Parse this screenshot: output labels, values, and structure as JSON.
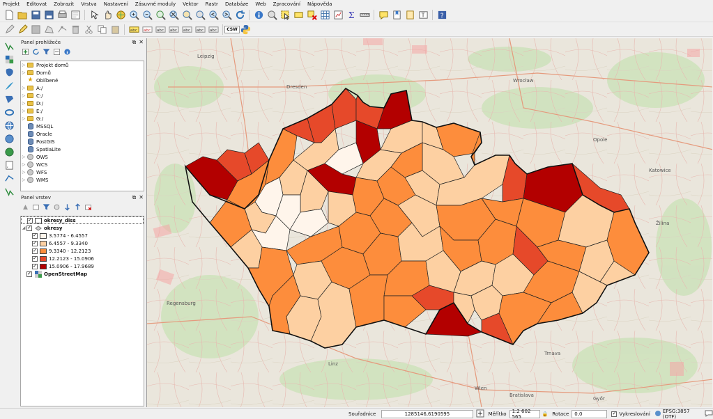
{
  "menu": [
    "Projekt",
    "Editovat",
    "Zobrazit",
    "Vrstva",
    "Nastavení",
    "Zásuvné moduly",
    "Vektor",
    "Rastr",
    "Databáze",
    "Web",
    "Zpracování",
    "Nápověda"
  ],
  "toolbar": {
    "csw_label": "CSW"
  },
  "browser_panel": {
    "title": "Panel prohlížeče",
    "items": [
      {
        "label": "Projekt domů",
        "icon": "folder-icon"
      },
      {
        "label": "Domů",
        "icon": "folder-icon"
      },
      {
        "label": "Oblíbené",
        "icon": "star-icon"
      },
      {
        "label": "A:/",
        "icon": "folder-icon"
      },
      {
        "label": "C:/",
        "icon": "folder-icon"
      },
      {
        "label": "D:/",
        "icon": "folder-icon"
      },
      {
        "label": "E:/",
        "icon": "folder-icon"
      },
      {
        "label": "G:/",
        "icon": "folder-icon"
      },
      {
        "label": "MSSQL",
        "icon": "database-icon"
      },
      {
        "label": "Oracle",
        "icon": "database-icon"
      },
      {
        "label": "PostGIS",
        "icon": "database-icon"
      },
      {
        "label": "SpatiaLite",
        "icon": "database-icon"
      },
      {
        "label": "OWS",
        "icon": "globe-icon"
      },
      {
        "label": "WCS",
        "icon": "globe-icon"
      },
      {
        "label": "WFS",
        "icon": "globe-icon"
      },
      {
        "label": "WMS",
        "icon": "globe-icon"
      }
    ]
  },
  "layers_panel": {
    "title": "Panel vrstev",
    "layers": [
      {
        "name": "okresy_diss"
      },
      {
        "name": "okresy"
      }
    ],
    "legend": [
      {
        "label": "3.5774 - 6.4557",
        "color": "#fff5eb"
      },
      {
        "label": "6.4557 - 9.3340",
        "color": "#fdd0a2"
      },
      {
        "label": "9.3340 - 12.2123",
        "color": "#fd8d3c"
      },
      {
        "label": "12.2123 - 15.0906",
        "color": "#e6492a"
      },
      {
        "label": "15.0906 - 17.9689",
        "color": "#b30000"
      }
    ],
    "basemap": "OpenStreetMap"
  },
  "map_labels": {
    "leipzig": "Leipzig",
    "dresden": "Dresden",
    "wroclaw": "Wrocław",
    "katowice": "Katowice",
    "regensburg": "Regensburg",
    "wien": "Wien",
    "bratislava": "Bratislava",
    "gyor": "Győr",
    "olsztyn_label": "Opole",
    "zilina": "Žilina",
    "trnava": "Trnava",
    "linz": "Linz"
  },
  "status": {
    "coord_label": "Souřadnice",
    "coord_value": "1285146,6190595",
    "scale_label": "Měřítko",
    "scale_value": "1:2 602 565",
    "rotation_label": "Rotace",
    "rotation_value": "0,0",
    "render_label": "Vykreslování",
    "crs": "EPSG:3857 (OTF)"
  }
}
